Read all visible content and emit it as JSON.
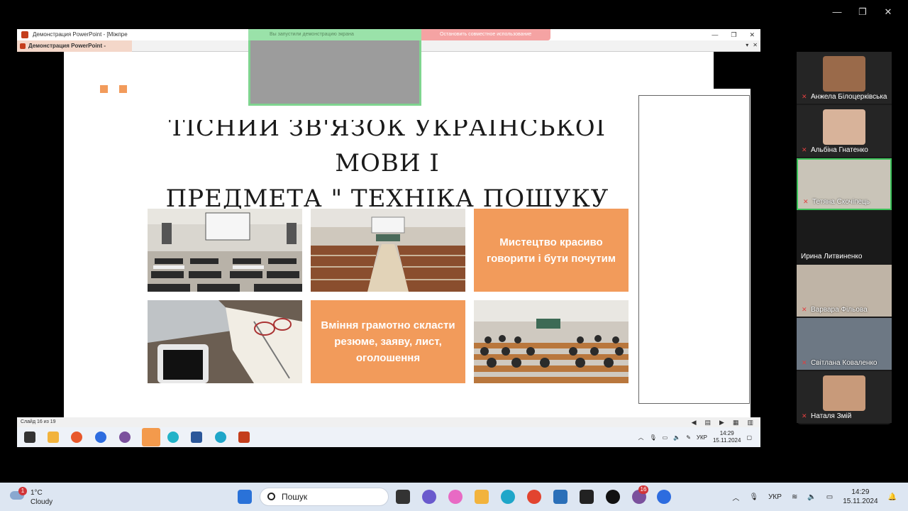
{
  "outer_window": {
    "minimize": "—",
    "maximize": "❐",
    "close": "✕"
  },
  "ppt_window": {
    "title": "Демонстрация PowerPoint - [Міжпре",
    "tab_title": "Демонстрация PowerPoint - [Міжпрез",
    "min": "—",
    "max": "❐",
    "close": "✕",
    "restore_btn": "▾",
    "close_btn": "✕"
  },
  "share_bar": {
    "notice": "Вы запустили демонстрацию экрана",
    "stop": "Остановить совместное использование"
  },
  "slide": {
    "title_line1": "ТІСНИЙ ЗВ'ЯЗОК УКРАЇНСЬКОЇ МОВИ І",
    "title_line2": "ПРЕДМЕТА \" ТЕХНІКА ПОШУКУ РОБОТИ",
    "tile_top_right": "Мистецтво красиво говорити  і бути почутим",
    "tile_bottom_middle": "Вміння грамотно скласти резюме, заяву, лист, оголошення",
    "colors": {
      "accent": "#f29b5b"
    }
  },
  "ppt_status": {
    "slide_info": "Слайд 16 из 19"
  },
  "inner_taskbar": {
    "lang": "УКР",
    "time": "14:29",
    "date": "15.11.2024"
  },
  "participants": [
    {
      "name": "Анжела Білоцерківська",
      "muted": true
    },
    {
      "name": "Альбіна Гнатенко",
      "muted": true
    },
    {
      "name": "Тетяна Скочіпець",
      "muted": true,
      "active": true
    },
    {
      "name": "Ирина Литвиненко",
      "muted": false
    },
    {
      "name": "Варвара Фільова",
      "muted": true
    },
    {
      "name": "Світлана Коваленко",
      "muted": true
    },
    {
      "name": "Наталя Змій",
      "muted": true
    }
  ],
  "taskbar": {
    "weather_temp": "1°C",
    "weather_desc": "Cloudy",
    "weather_badge": "1",
    "search_placeholder": "Пошук",
    "viber_badge": "16",
    "lang": "УКР",
    "time": "14:29",
    "date": "15.11.2024"
  }
}
